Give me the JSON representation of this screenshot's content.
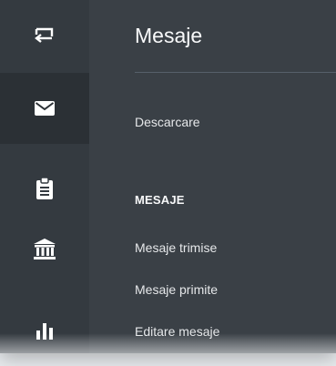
{
  "rail": {
    "items": [
      {
        "icon": "swap-icon"
      },
      {
        "icon": "mail-icon",
        "active": true
      },
      {
        "icon": "clipboard-icon"
      },
      {
        "icon": "bank-icon"
      },
      {
        "icon": "bar-chart-icon"
      }
    ]
  },
  "panel": {
    "title": "Mesaje",
    "download_label": "Descarcare",
    "section_heading": "MESAJE",
    "links": {
      "sent": "Mesaje trimise",
      "received": "Mesaje primite",
      "edit": "Editare mesaje"
    }
  },
  "colors": {
    "rail_bg": "#343a40",
    "panel_bg": "#3a4046",
    "active_bg": "#2b3035",
    "text": "#e6e8ea",
    "icon": "#ffffff"
  }
}
